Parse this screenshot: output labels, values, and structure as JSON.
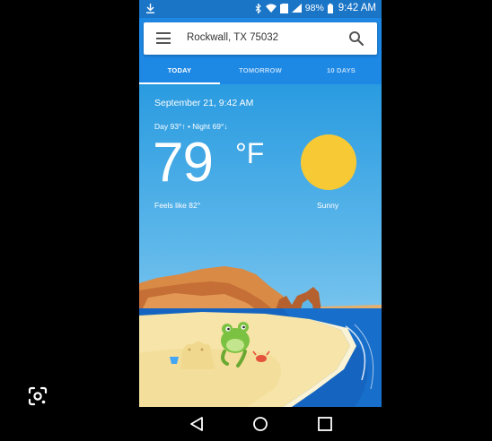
{
  "status_bar": {
    "battery_percent": "98%",
    "time": "9:42 AM"
  },
  "search": {
    "location": "Rockwall, TX 75032"
  },
  "tabs": [
    {
      "label": "TODAY",
      "active": true
    },
    {
      "label": "TOMORROW",
      "active": false
    },
    {
      "label": "10 DAYS",
      "active": false
    }
  ],
  "weather": {
    "datetime": "September 21, 9:42 AM",
    "day_night": "Day 93°↑ • Night 69°↓",
    "temperature": "79",
    "unit": "°F",
    "feels_like": "Feels like 82°",
    "condition": "Sunny"
  },
  "colors": {
    "header": "#1e88e5",
    "status_bar": "#1a75c7",
    "sun": "#f7c935",
    "sea": "#1565c0",
    "sand": "#f6e4a8"
  }
}
